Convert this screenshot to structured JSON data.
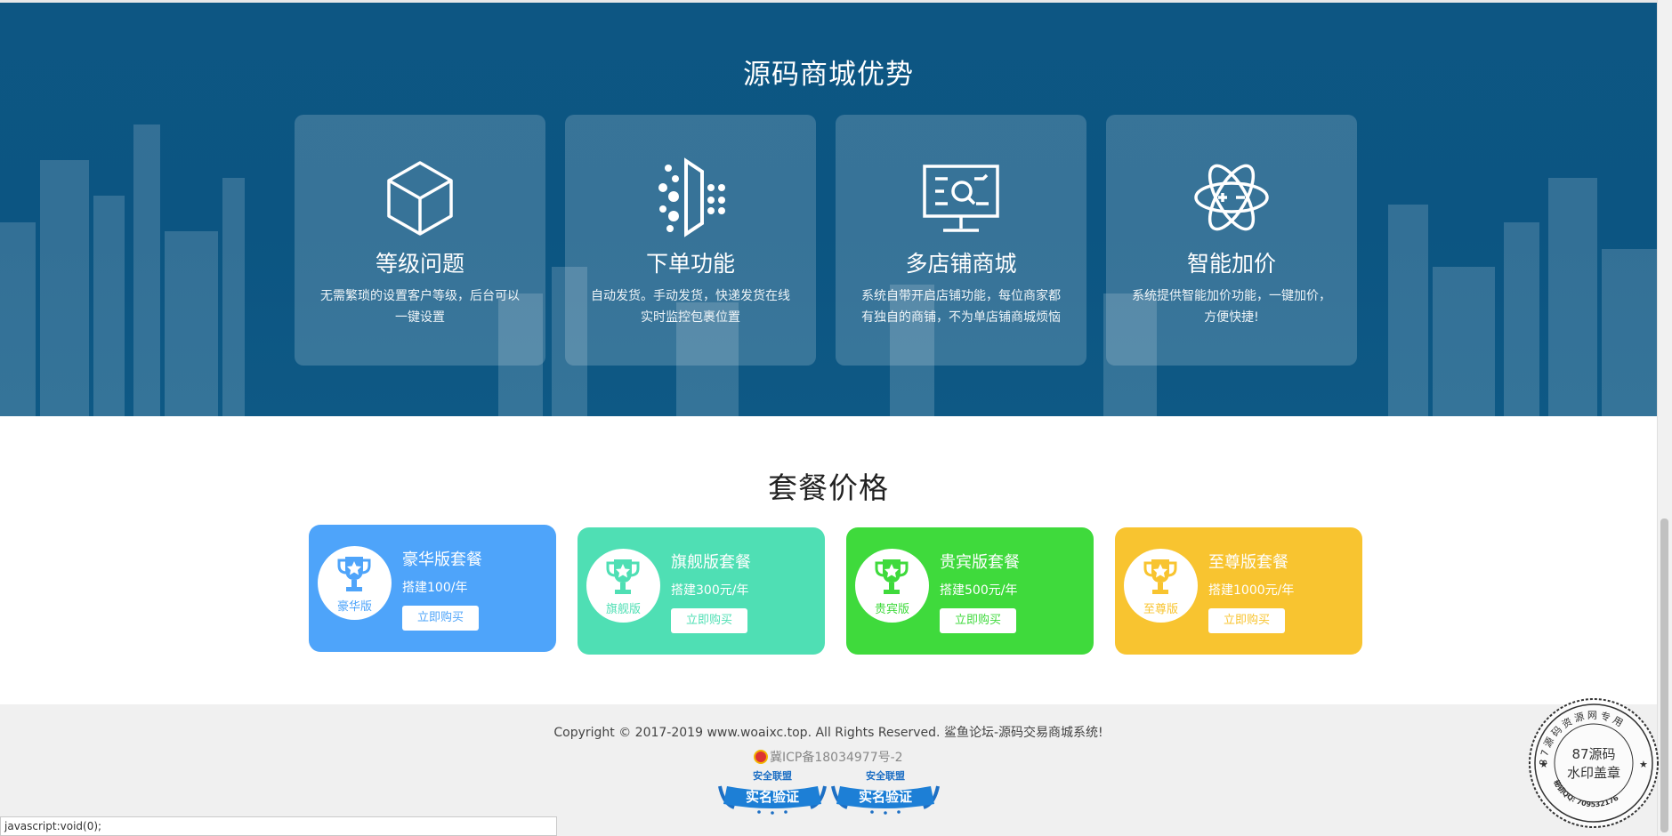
{
  "advantages": {
    "title": "源码商城优势",
    "cards": [
      {
        "icon": "cube-icon",
        "title": "等级问题",
        "line1": "无需繁琐的设置客户等级，后台可以",
        "line2": "一键设置"
      },
      {
        "icon": "delivery-icon",
        "title": "下单功能",
        "line1": "自动发货。手动发货，快递发货在线",
        "line2": "实时监控包裹位置"
      },
      {
        "icon": "monitor-icon",
        "title": "多店铺商城",
        "line1": "系统自带开启店铺功能，每位商家都",
        "line2": "有独自的商铺，不为单店铺商城烦恼"
      },
      {
        "icon": "atom-icon",
        "title": "智能加价",
        "line1": "系统提供智能加价功能，一键加价，",
        "line2": "方便快捷!"
      }
    ]
  },
  "pricing": {
    "title": "套餐价格",
    "plans": [
      {
        "badge": "豪华版",
        "name": "豪华版套餐",
        "price": "搭建100/年",
        "button": "立即购买",
        "color": "#4ea4fa"
      },
      {
        "badge": "旗舰版",
        "name": "旗舰版套餐",
        "price": "搭建300元/年",
        "button": "立即购买",
        "color": "#4fdfb4"
      },
      {
        "badge": "贵宾版",
        "name": "贵宾版套餐",
        "price": "搭建500元/年",
        "button": "立即购买",
        "color": "#3fda3c"
      },
      {
        "badge": "至尊版",
        "name": "至尊版套餐",
        "price": "搭建1000元/年",
        "button": "立即购买",
        "color": "#f8c430"
      }
    ]
  },
  "footer": {
    "copyright": "Copyright © 2017-2019 www.woaixc.top. All Rights Reserved. 鲨鱼论坛-源码交易商城系统!",
    "icp": "冀ICP备18034977号-2",
    "verify_top": "安全联盟",
    "verify_main": "实名验证"
  },
  "status_bar": "javascript:void(0);",
  "stamp": {
    "ring_text": "87源码资源网专用",
    "line1": "87源码",
    "line2": "水印盖章",
    "bottom_text": "秘钥QQ: 709532176"
  },
  "colors": {
    "hero_bg": "#0c5582",
    "footer_bg": "#f0f0f0"
  }
}
